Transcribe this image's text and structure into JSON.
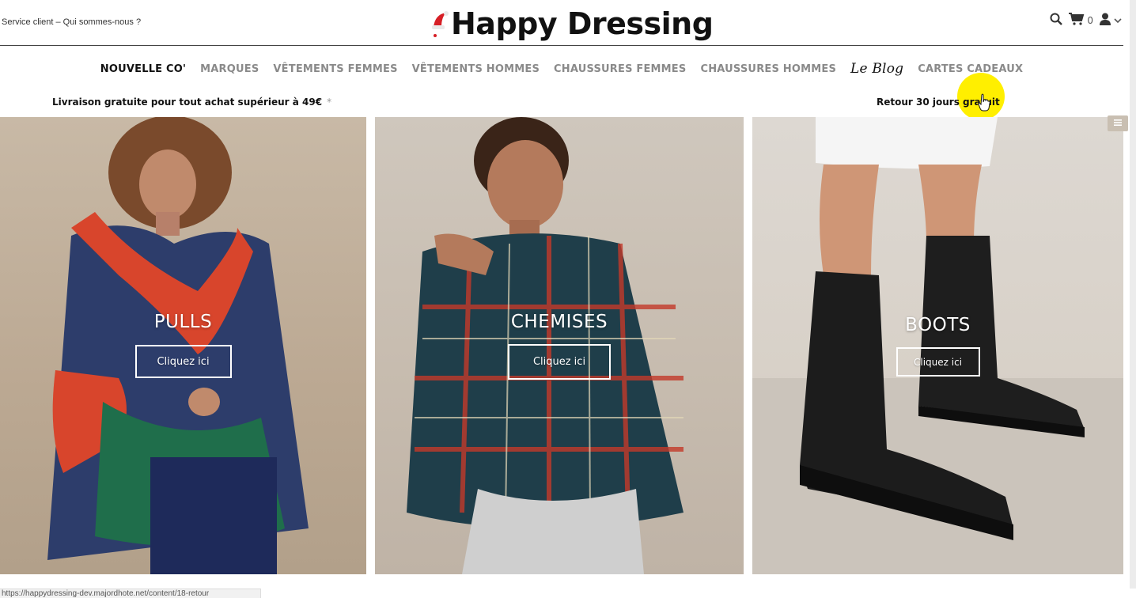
{
  "header": {
    "service_link": "Service client – Qui sommes-nous ?",
    "logo_text": "Happy Dressing",
    "cart_count": "0",
    "icons": [
      "search-icon",
      "cart-icon",
      "user-icon",
      "chevron-down-icon"
    ]
  },
  "nav": {
    "items": [
      {
        "label": "NOUVELLE CO'"
      },
      {
        "label": "MARQUES"
      },
      {
        "label": "VÊTEMENTS FEMMES"
      },
      {
        "label": "VÊTEMENTS HOMMES"
      },
      {
        "label": "CHAUSSURES FEMMES"
      },
      {
        "label": "CHAUSSURES HOMMES"
      },
      {
        "label": "Le Blog"
      },
      {
        "label": "CARTES CADEAUX"
      }
    ]
  },
  "promo": {
    "left": "Livraison gratuite pour tout achat supérieur à 49€",
    "left_star": "*",
    "right": "Retour 30 jours gratuit"
  },
  "cards": [
    {
      "title": "PULLS",
      "button": "Cliquez ici"
    },
    {
      "title": "CHEMISES",
      "button": "Cliquez ici"
    },
    {
      "title": "BOOTS",
      "button": "Cliquez ici"
    }
  ],
  "status_bar": "https://happydressing-dev.majordhote.net/content/18-retour",
  "colors": {
    "accent": "#ffef00",
    "nav_active": "#111111",
    "nav_default": "#8a8a8a"
  }
}
